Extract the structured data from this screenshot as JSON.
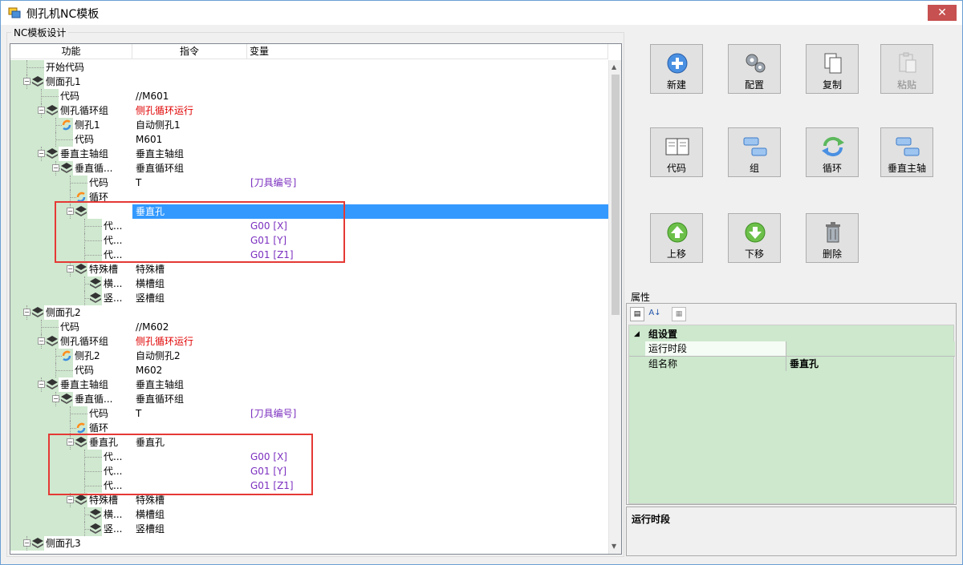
{
  "window": {
    "title": "侧孔机NC模板",
    "close_glyph": "✕"
  },
  "groupbox": {
    "label": "NC模板设计"
  },
  "tree": {
    "columns": [
      "功能",
      "指令",
      "变量"
    ],
    "rows": [
      {
        "label": "开始代码",
        "cmd": "",
        "var": "",
        "icon": "",
        "indent": 3
      },
      {
        "label": "侧面孔1",
        "cmd": "",
        "var": "",
        "icon": "layers",
        "indent": 3,
        "pm": "-"
      },
      {
        "label": "代码",
        "cmd": "//M601",
        "var": "",
        "icon": "",
        "indent": 4
      },
      {
        "label": "侧孔循环组",
        "cmd": "侧孔循环运行",
        "cmdColor": "red",
        "var": "",
        "icon": "layers",
        "indent": 4,
        "pm": "-"
      },
      {
        "label": "侧孔1",
        "cmd": "自动侧孔1",
        "var": "",
        "icon": "loop",
        "indent": 5
      },
      {
        "label": "代码",
        "cmd": "M601",
        "var": "",
        "icon": "",
        "indent": 5
      },
      {
        "label": "垂直主轴组",
        "cmd": "垂直主轴组",
        "var": "",
        "icon": "layers",
        "indent": 4,
        "pm": "-"
      },
      {
        "label": "垂直循...",
        "cmd": "垂直循环组",
        "var": "",
        "icon": "layers",
        "indent": 5,
        "pm": "-"
      },
      {
        "label": "代码",
        "cmd": "T",
        "var": "[刀具编号]",
        "icon": "",
        "indent": 6
      },
      {
        "label": "循环",
        "cmd": "",
        "var": "",
        "icon": "loop",
        "indent": 6
      },
      {
        "label": "垂直孔",
        "cmd": "垂直孔",
        "var": "",
        "icon": "layers",
        "indent": 6,
        "pm": "-",
        "selected": true
      },
      {
        "label": "代...",
        "cmd": "",
        "var": "G00 [X]",
        "icon": "",
        "indent": 7
      },
      {
        "label": "代...",
        "cmd": "",
        "var": "G01 [Y]",
        "icon": "",
        "indent": 7
      },
      {
        "label": "代...",
        "cmd": "",
        "var": "G01 [Z1]",
        "icon": "",
        "indent": 7
      },
      {
        "label": "特殊槽",
        "cmd": "特殊槽",
        "var": "",
        "icon": "layers",
        "indent": 6,
        "pm": "-"
      },
      {
        "label": "横...",
        "cmd": "横槽组",
        "var": "",
        "icon": "layers",
        "indent": 7
      },
      {
        "label": "竖...",
        "cmd": "竖槽组",
        "var": "",
        "icon": "layers",
        "indent": 7
      },
      {
        "label": "侧面孔2",
        "cmd": "",
        "var": "",
        "icon": "layers",
        "indent": 3,
        "pm": "-"
      },
      {
        "label": "代码",
        "cmd": "//M602",
        "var": "",
        "icon": "",
        "indent": 4
      },
      {
        "label": "侧孔循环组",
        "cmd": "侧孔循环运行",
        "cmdColor": "red",
        "var": "",
        "icon": "layers",
        "indent": 4,
        "pm": "-"
      },
      {
        "label": "侧孔2",
        "cmd": "自动侧孔2",
        "var": "",
        "icon": "loop",
        "indent": 5
      },
      {
        "label": "代码",
        "cmd": "M602",
        "var": "",
        "icon": "",
        "indent": 5
      },
      {
        "label": "垂直主轴组",
        "cmd": "垂直主轴组",
        "var": "",
        "icon": "layers",
        "indent": 4,
        "pm": "-"
      },
      {
        "label": "垂直循...",
        "cmd": "垂直循环组",
        "var": "",
        "icon": "layers",
        "indent": 5,
        "pm": "-"
      },
      {
        "label": "代码",
        "cmd": "T",
        "var": "[刀具编号]",
        "icon": "",
        "indent": 6
      },
      {
        "label": "循环",
        "cmd": "",
        "var": "",
        "icon": "loop",
        "indent": 6
      },
      {
        "label": "垂直孔",
        "cmd": "垂直孔",
        "var": "",
        "icon": "layers",
        "indent": 6,
        "pm": "-"
      },
      {
        "label": "代...",
        "cmd": "",
        "var": "G00 [X]",
        "icon": "",
        "indent": 7
      },
      {
        "label": "代...",
        "cmd": "",
        "var": "G01 [Y]",
        "icon": "",
        "indent": 7
      },
      {
        "label": "代...",
        "cmd": "",
        "var": "G01 [Z1]",
        "icon": "",
        "indent": 7
      },
      {
        "label": "特殊槽",
        "cmd": "特殊槽",
        "var": "",
        "icon": "layers",
        "indent": 6,
        "pm": "-"
      },
      {
        "label": "横...",
        "cmd": "横槽组",
        "var": "",
        "icon": "layers",
        "indent": 7
      },
      {
        "label": "竖...",
        "cmd": "竖槽组",
        "var": "",
        "icon": "layers",
        "indent": 7
      },
      {
        "label": "侧面孔3",
        "cmd": "",
        "var": "",
        "icon": "layers",
        "indent": 3,
        "pm": "-"
      }
    ]
  },
  "buttons": [
    {
      "id": "new",
      "label": "新建",
      "icon": "plus-circle-icon",
      "disabled": false
    },
    {
      "id": "config",
      "label": "配置",
      "icon": "gears-icon",
      "disabled": false
    },
    {
      "id": "copy",
      "label": "复制",
      "icon": "copy-icon",
      "disabled": false
    },
    {
      "id": "paste",
      "label": "粘贴",
      "icon": "paste-icon",
      "disabled": true
    },
    {
      "id": "code",
      "label": "代码",
      "icon": "book-icon",
      "disabled": false
    },
    {
      "id": "group",
      "label": "组",
      "icon": "group-icon",
      "disabled": false
    },
    {
      "id": "loop",
      "label": "循环",
      "icon": "loop-arrows-icon",
      "disabled": false
    },
    {
      "id": "vspindle",
      "label": "垂直主轴",
      "icon": "group-icon",
      "disabled": false
    },
    {
      "id": "up",
      "label": "上移",
      "icon": "arrow-up-icon",
      "disabled": false
    },
    {
      "id": "down",
      "label": "下移",
      "icon": "arrow-down-icon",
      "disabled": false
    },
    {
      "id": "delete",
      "label": "删除",
      "icon": "trash-icon",
      "disabled": false
    }
  ],
  "properties": {
    "label": "属性",
    "category": "组设置",
    "rows": [
      {
        "name": "运行时段",
        "value": ""
      },
      {
        "name": "组名称",
        "value": "垂直孔"
      }
    ],
    "description_title": "运行时段"
  },
  "colors": {
    "selection": "#3399ff",
    "gutter": "#cfe8cf",
    "red_text": "#e00000",
    "purple_text": "#7b2fbf",
    "highlight_box": "#e53935"
  }
}
